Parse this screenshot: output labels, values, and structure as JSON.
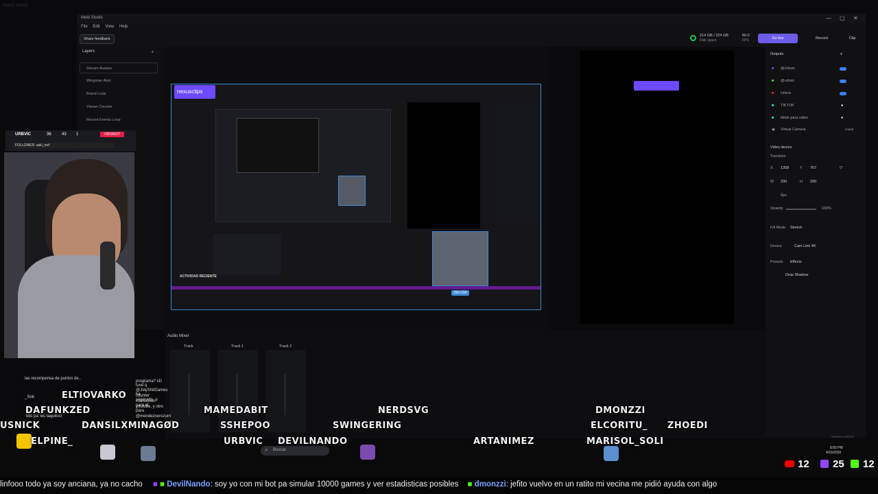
{
  "corner_text": "meld hash",
  "app": {
    "title": "Meld Studio",
    "menu": [
      "File",
      "Edit",
      "View",
      "Help"
    ],
    "share": "Share feedback",
    "disk": "214 GB / 224 GB",
    "disk_label": "Disk space",
    "fps": "60.0",
    "fps_label": "FPS",
    "golive": "Go live",
    "record": "Record",
    "clip": "Clip"
  },
  "layers": {
    "title": "Layers",
    "items": [
      "Stream Avatars",
      "Wingman Alert",
      "Brand Loop",
      "Viewer Counter",
      "Recent Events Loop"
    ]
  },
  "preview": {
    "brand": "nexusclips",
    "size_badge": "290×290",
    "recent": "ACTIVIDAD RECIENTE"
  },
  "outputs": {
    "title": "Outputs",
    "items": [
      "@Urbvic",
      "@urbvic",
      "Urbvic",
      "TIKTOK",
      "tiktok para video",
      "Virtual Camera"
    ],
    "install": "Install"
  },
  "video": {
    "title": "Video device",
    "transform": "Transform",
    "x_label": "X",
    "x": "1358",
    "y_label": "Y",
    "y": "767",
    "rot": "0°",
    "w_label": "W",
    "w": "290",
    "h_label": "H",
    "h": "290",
    "px": "0px",
    "opacity_label": "Opacity",
    "opacity": "100%",
    "fill_label": "Fill Mode",
    "fill": "Stretch",
    "device_label": "Device",
    "device": "Cam Link 4K",
    "presets": "Presets",
    "effects": "Effects",
    "shadow": "Drop Shadow"
  },
  "audio": {
    "title": "Audio Mixer",
    "tracks": [
      "Track",
      "Track 1",
      "Track 2"
    ]
  },
  "version": "Version 0.10.0.0",
  "overlay": {
    "name": "URBVIC",
    "v1": "36",
    "v2": "43",
    "v3": "1",
    "tag": "OBSBOT",
    "follow": "FOLLOWER: aski_mcf"
  },
  "chat": {
    "lines": [
      "las recompensa de puntos de..",
      "programa? xD tuve q",
      "_Soli:",
      "@JolyShitGames ha",
      "counter separado, o",
      "instruccion para el",
      "youtube, y otro para",
      "bits pa' los taquitos!",
      "@mendeznerozurri"
    ]
  },
  "viewers": [
    "ELTIOVARKO",
    "DAFUNKZED",
    "DANSILXMINAGØD",
    "USNICK",
    "ELPINE_",
    "MAMEDABIT",
    "SSHEPOO",
    "URBVIC",
    "DEVILNANDO",
    "NERDSVG",
    "SWINGERING",
    "ARTANIMEZ",
    "DMONZZI",
    "ELCORITU_",
    "ZHOEDI",
    "MARISOL_SOLI"
  ],
  "taskbar": {
    "search": "Buscar",
    "time": "8:55 PM",
    "date": "4/16/2026"
  },
  "counts": {
    "youtube": "12",
    "twitch": "25",
    "kick": "12"
  },
  "ticker": {
    "seg1": "linfooo todo ya soy anciana, ya no cacho",
    "name2": "DevilNando",
    "seg2": ": soy yo con mi bot pa simular 10000 games y ver estadisticas posibles",
    "name3": "dmonzzi",
    "seg3": ": jefito vuelvo en un ratito mi vecina me pidió ayuda con algo"
  }
}
